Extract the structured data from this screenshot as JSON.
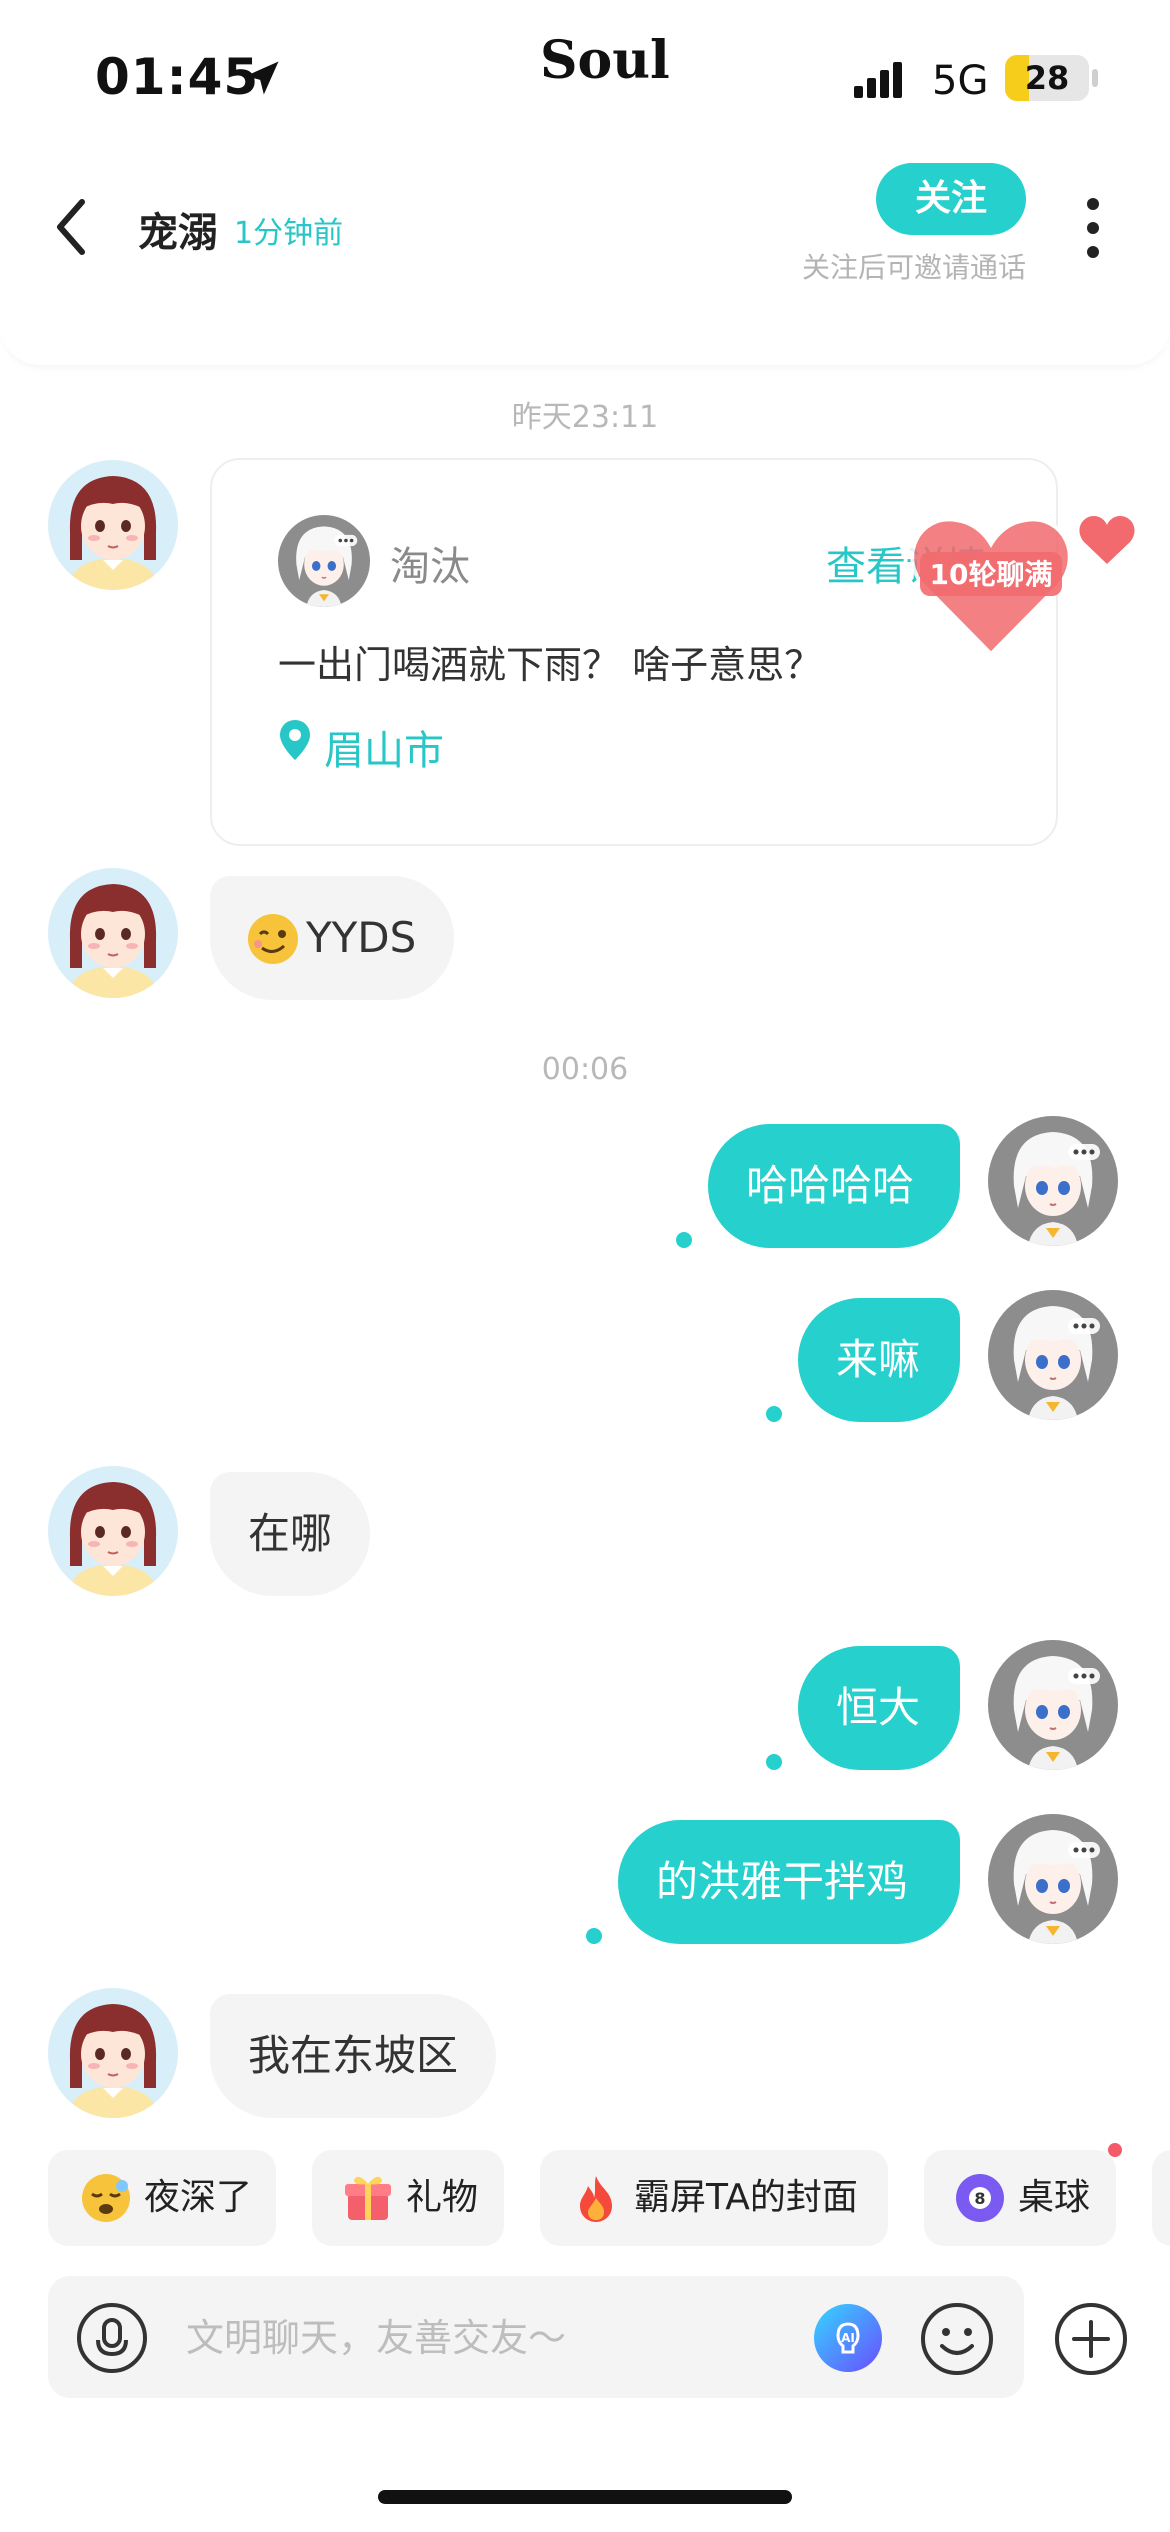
{
  "status_bar": {
    "time": "01:45",
    "brand": "Soul",
    "network": "5G",
    "battery": "28",
    "battery_level": 0.28
  },
  "header": {
    "name": "宠溺",
    "last_seen": "1分钟前",
    "follow_label": "关注",
    "follow_hint": "关注后可邀请通话"
  },
  "messages": {
    "ts1": "昨天23:11",
    "card": {
      "author": "淘汰",
      "view_label": "查看详情",
      "text": "一出门喝酒就下雨？  啥子意思？",
      "location": "眉山市",
      "badge": "10轮聊满"
    },
    "m1": "YYDS",
    "ts2": "00:06",
    "m2": "哈哈哈哈",
    "m3": "来嘛",
    "m4": "在哪",
    "m5": "恒大",
    "m6": "的洪雅干拌鸡",
    "m7": "我在东坡区"
  },
  "chips": [
    "夜深了",
    "礼物",
    "霸屏TA的封面",
    "桌球"
  ],
  "input": {
    "placeholder": "文明聊天，友善交友～"
  },
  "colors": {
    "accent": "#25d0cd",
    "bubble_in": "#f4f4f4",
    "heart": "#f26a6e"
  }
}
